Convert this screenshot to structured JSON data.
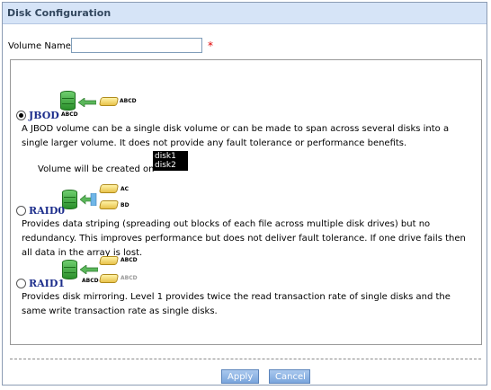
{
  "header": {
    "title": "Disk Configuration"
  },
  "volume": {
    "label": "Volume Name",
    "value": "",
    "required_mark": "*"
  },
  "options": [
    {
      "name": "JBOD",
      "selected": true,
      "icon_labels": [
        "ABCD",
        "ABCD"
      ],
      "description": "A JBOD volume can be a single disk volume or can be made to span across several disks into a single larger volume. It does not provide any fault tolerance or performance benefits."
    },
    {
      "name": "RAID0",
      "selected": false,
      "icon_labels": [
        "AC",
        "BD"
      ],
      "description": "Provides data striping (spreading out blocks of each file across multiple disk drives) but no redundancy. This improves performance but does not deliver fault tolerance. If one drive fails then all data in the array is lost."
    },
    {
      "name": "RAID1",
      "selected": false,
      "icon_labels": [
        "ABCD",
        "ABCD",
        "ABCD"
      ],
      "description": "Provides disk mirroring. Level 1 provides twice the read transaction rate of single disks and the same write transaction rate as single disks."
    }
  ],
  "jbod_created": {
    "label": "Volume will be created on",
    "disks": [
      "disk1",
      "disk2"
    ]
  },
  "buttons": {
    "apply": "Apply",
    "cancel": "Cancel"
  },
  "colors": {
    "header_bg": "#d6e4f7",
    "title_text": "#1d2e8c",
    "required": "#e00000",
    "button": "#7aa5dc"
  }
}
